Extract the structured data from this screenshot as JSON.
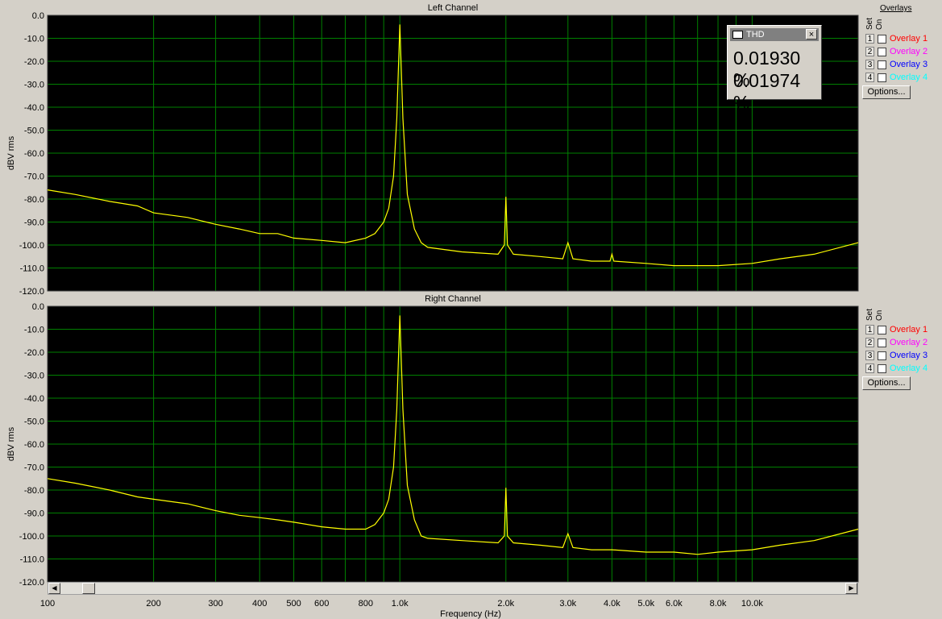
{
  "chart_data": [
    {
      "type": "line",
      "title": "Left Channel",
      "xlabel": "",
      "ylabel": "dBV rms",
      "xscale": "log",
      "xlim": [
        100,
        20000
      ],
      "ylim": [
        -120,
        0
      ],
      "grid": true,
      "yticks": [
        "0.0",
        "-10.0",
        "-20.0",
        "-30.0",
        "-40.0",
        "-50.0",
        "-60.0",
        "-70.0",
        "-80.0",
        "-90.0",
        "-100.0",
        "-110.0",
        "-120.0"
      ],
      "series": [
        {
          "color": "#ffff00",
          "x": [
            100,
            120,
            150,
            180,
            200,
            250,
            300,
            350,
            400,
            450,
            500,
            600,
            700,
            800,
            850,
            900,
            930,
            960,
            980,
            1000,
            1020,
            1050,
            1100,
            1150,
            1200,
            1500,
            1900,
            1980,
            2000,
            2020,
            2100,
            2500,
            2900,
            3000,
            3100,
            3500,
            3950,
            4000,
            4050,
            5000,
            6000,
            7000,
            8000,
            10000,
            12000,
            15000,
            20000
          ],
          "y": [
            -76,
            -78,
            -81,
            -83,
            -86,
            -88,
            -91,
            -93,
            -95,
            -95,
            -97,
            -98,
            -99,
            -97,
            -95,
            -90,
            -84,
            -70,
            -45,
            -4,
            -45,
            -78,
            -93,
            -99,
            -101,
            -103,
            -104,
            -100,
            -79,
            -100,
            -104,
            -105,
            -106,
            -99,
            -106,
            -107,
            -107,
            -104,
            -107,
            -108,
            -109,
            -109,
            -109,
            -108,
            -106,
            -104,
            -99
          ]
        }
      ]
    },
    {
      "type": "line",
      "title": "Right Channel",
      "xlabel": "Frequency (Hz)",
      "ylabel": "dBV rms",
      "xscale": "log",
      "xlim": [
        100,
        20000
      ],
      "ylim": [
        -120,
        0
      ],
      "grid": true,
      "yticks": [
        "0.0",
        "-10.0",
        "-20.0",
        "-30.0",
        "-40.0",
        "-50.0",
        "-60.0",
        "-70.0",
        "-80.0",
        "-90.0",
        "-100.0",
        "-110.0",
        "-120.0"
      ],
      "xticks": [
        "100",
        "200",
        "300",
        "400",
        "500",
        "600",
        "800",
        "1.0k",
        "2.0k",
        "3.0k",
        "4.0k",
        "5.0k",
        "6.0k",
        "8.0k",
        "10.0k"
      ],
      "series": [
        {
          "color": "#ffff00",
          "x": [
            100,
            120,
            150,
            180,
            200,
            250,
            300,
            350,
            400,
            450,
            500,
            600,
            700,
            800,
            850,
            900,
            930,
            960,
            980,
            1000,
            1020,
            1050,
            1100,
            1150,
            1200,
            1500,
            1900,
            1980,
            2000,
            2020,
            2100,
            2500,
            2900,
            3000,
            3100,
            3500,
            4000,
            5000,
            6000,
            7000,
            8000,
            10000,
            12000,
            15000,
            20000
          ],
          "y": [
            -75,
            -77,
            -80,
            -83,
            -84,
            -86,
            -89,
            -91,
            -92,
            -93,
            -94,
            -96,
            -97,
            -97,
            -95,
            -90,
            -84,
            -70,
            -45,
            -4,
            -45,
            -78,
            -93,
            -100,
            -101,
            -102,
            -103,
            -100,
            -79,
            -100,
            -103,
            -104,
            -105,
            -99,
            -105,
            -106,
            -106,
            -107,
            -107,
            -108,
            -107,
            -106,
            -104,
            -102,
            -97
          ]
        }
      ]
    }
  ],
  "overlays": {
    "heading": "Overlays",
    "set_label": "Set",
    "on_label": "On",
    "items": [
      {
        "num": "1",
        "label": "Overlay 1",
        "color": "#ff0000"
      },
      {
        "num": "2",
        "label": "Overlay 2",
        "color": "#ff00ff"
      },
      {
        "num": "3",
        "label": "Overlay 3",
        "color": "#0000ff"
      },
      {
        "num": "4",
        "label": "Overlay 4",
        "color": "#00ffff"
      }
    ],
    "options_label": "Options..."
  },
  "thd": {
    "title": "THD",
    "close": "×",
    "value_left": "0.01930 %",
    "value_right": "0.01974 %"
  },
  "toolbar": {
    "st_icon": "st-icon",
    "sine_icon": "sine-wave-icon"
  },
  "colors": {
    "plot_bg": "#000000",
    "grid": "#008000",
    "trace": "#ffff00",
    "panel_bg": "#d4d0c8"
  }
}
